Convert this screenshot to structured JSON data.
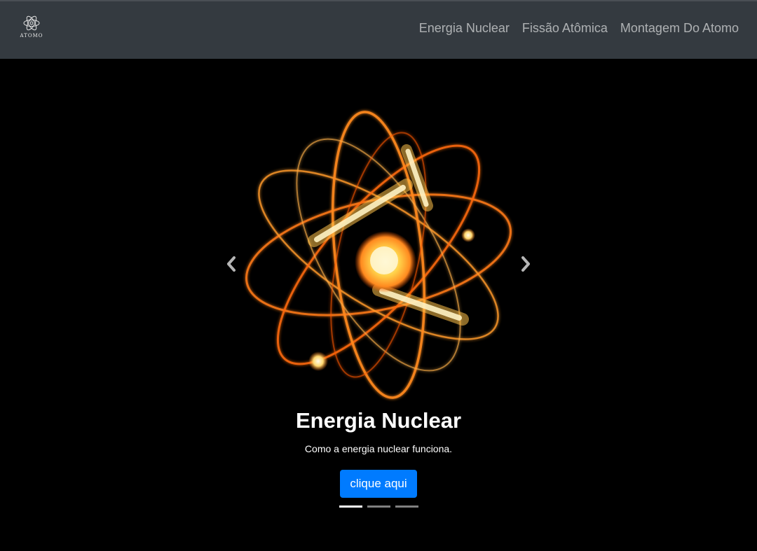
{
  "brand": {
    "text": "ATOMO",
    "icon": "atom-logo-icon"
  },
  "nav": {
    "items": [
      {
        "label": "Energia Nuclear"
      },
      {
        "label": "Fissão Atômica"
      },
      {
        "label": "Montagem Do Atomo"
      }
    ]
  },
  "carousel": {
    "slide": {
      "title": "Energia Nuclear",
      "subtitle": "Como a energia nuclear funciona.",
      "button_label": "clique aqui",
      "image": "glowing-atom-image"
    },
    "prev_icon": "chevron-left-icon",
    "next_icon": "chevron-right-icon",
    "indicator_count": 3,
    "active_indicator": 1
  },
  "colors": {
    "navbar_bg": "#343a40",
    "button_bg": "#007bff",
    "page_bg": "#000000",
    "glow": "#ff8a1f"
  }
}
